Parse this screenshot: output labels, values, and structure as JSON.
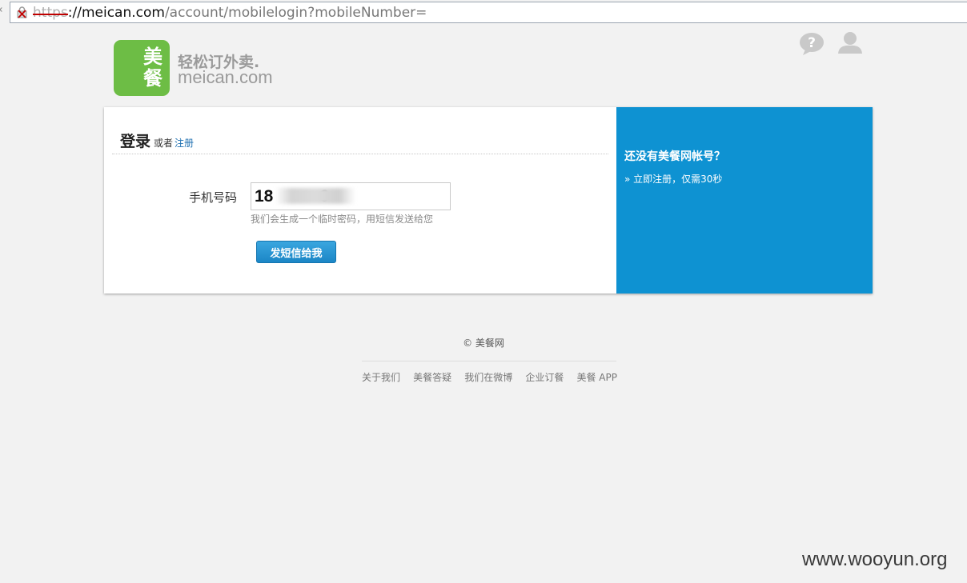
{
  "browser": {
    "url_scheme": "https",
    "url_host": "://meican.com",
    "url_path": "/account/mobilelogin?mobileNumber="
  },
  "header": {
    "logo_char_1": "美",
    "logo_char_2": "餐",
    "slogan": "轻松订外卖.",
    "site": "meican.com",
    "help_icon": "help-icon",
    "user_icon": "user-icon"
  },
  "login": {
    "title": "登录",
    "or": "或者",
    "register_link": "注册",
    "phone_label": "手机号码",
    "phone_value": "18          9",
    "hint": "我们会生成一个临时密码，用短信发送给您",
    "send_button": "发短信给我"
  },
  "side": {
    "title": "还没有美餐网帐号？",
    "link": "» 立即注册，仅需30秒"
  },
  "footer": {
    "copyright": "© 美餐网",
    "links": [
      "关于我们",
      "美餐答疑",
      "我们在微博",
      "企业订餐",
      "美餐 APP"
    ]
  },
  "watermark": "www.wooyun.org",
  "colors": {
    "brand_green": "#6dbd45",
    "side_blue": "#0e92d2",
    "button_blue": "#1b86c6",
    "link_blue": "#1d6fb0"
  }
}
